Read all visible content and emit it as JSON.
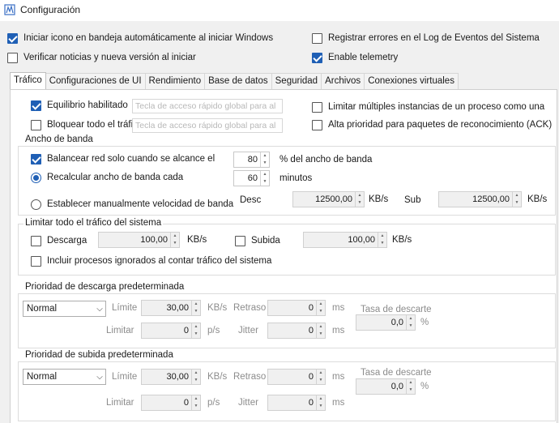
{
  "window": {
    "title": "Configuración"
  },
  "top_options": [
    {
      "label": "Iniciar icono en bandeja automáticamente al iniciar Windows",
      "checked": true
    },
    {
      "label": "Registrar errores en el Log de Eventos del Sistema",
      "checked": false
    },
    {
      "label": "Verificar noticias y nueva versión al iniciar",
      "checked": false
    },
    {
      "label": "Enable telemetry",
      "checked": true
    }
  ],
  "tabs": [
    "Tráfico",
    "Configuraciones de UI",
    "Rendimiento",
    "Base de datos",
    "Seguridad",
    "Archivos",
    "Conexiones virtuales"
  ],
  "active_tab": "Tráfico",
  "traffic": {
    "balance_label": "Equilibrio habilitado",
    "balance_checked": true,
    "block_label": "Bloquear todo el tráfico",
    "block_checked": false,
    "hotkey_placeholder": "Tecla de acceso rápido global para al",
    "limit_instances_label": "Limitar múltiples instancias de un proceso como una",
    "limit_instances_checked": false,
    "high_priority_label": "Alta prioridad para paquetes de reconocimiento (ACK)",
    "high_priority_checked": false
  },
  "bandwidth": {
    "title": "Ancho de banda",
    "balance_net_label": "Balancear red solo cuando se alcance el",
    "balance_net_checked": true,
    "balance_net_value": "80",
    "balance_net_unit": "% del ancho de banda",
    "recalc_label": "Recalcular ancho de banda cada",
    "recalc_value": "60",
    "recalc_unit": "minutos",
    "manual_label": "Establecer manualmente velocidad de banda",
    "desc_label": "Desc",
    "desc_value": "12500,00",
    "desc_unit": "KB/s",
    "sub_label": "Sub",
    "sub_value": "12500,00",
    "sub_unit": "KB/s"
  },
  "system_limit": {
    "title": "Limitar todo el tráfico del sistema",
    "download_label": "Descarga",
    "download_value": "100,00",
    "download_unit": "KB/s",
    "upload_label": "Subida",
    "upload_value": "100,00",
    "upload_unit": "KB/s",
    "ignored_label": "Incluir procesos ignorados al contar tráfico del sistema"
  },
  "download_priority": {
    "title": "Prioridad de descarga predeterminada",
    "select_value": "Normal",
    "limite_label": "Límite",
    "limite_value": "30,00",
    "limite_unit": "KB/s",
    "retraso_label": "Retraso",
    "retraso_value": "0",
    "retraso_unit": "ms",
    "limitar_label": "Limitar",
    "limitar_value": "0",
    "limitar_unit": "p/s",
    "jitter_label": "Jitter",
    "jitter_value": "0",
    "jitter_unit": "ms",
    "tasa_label": "Tasa de descarte",
    "tasa_value": "0,0",
    "tasa_unit": "%"
  },
  "upload_priority": {
    "title": "Prioridad de subida predeterminada",
    "select_value": "Normal",
    "limite_label": "Límite",
    "limite_value": "30,00",
    "limite_unit": "KB/s",
    "retraso_label": "Retraso",
    "retraso_value": "0",
    "retraso_unit": "ms",
    "limitar_label": "Limitar",
    "limitar_value": "0",
    "limitar_unit": "p/s",
    "jitter_label": "Jitter",
    "jitter_value": "0",
    "jitter_unit": "ms",
    "tasa_label": "Tasa de descarte",
    "tasa_value": "0,0",
    "tasa_unit": "%"
  }
}
